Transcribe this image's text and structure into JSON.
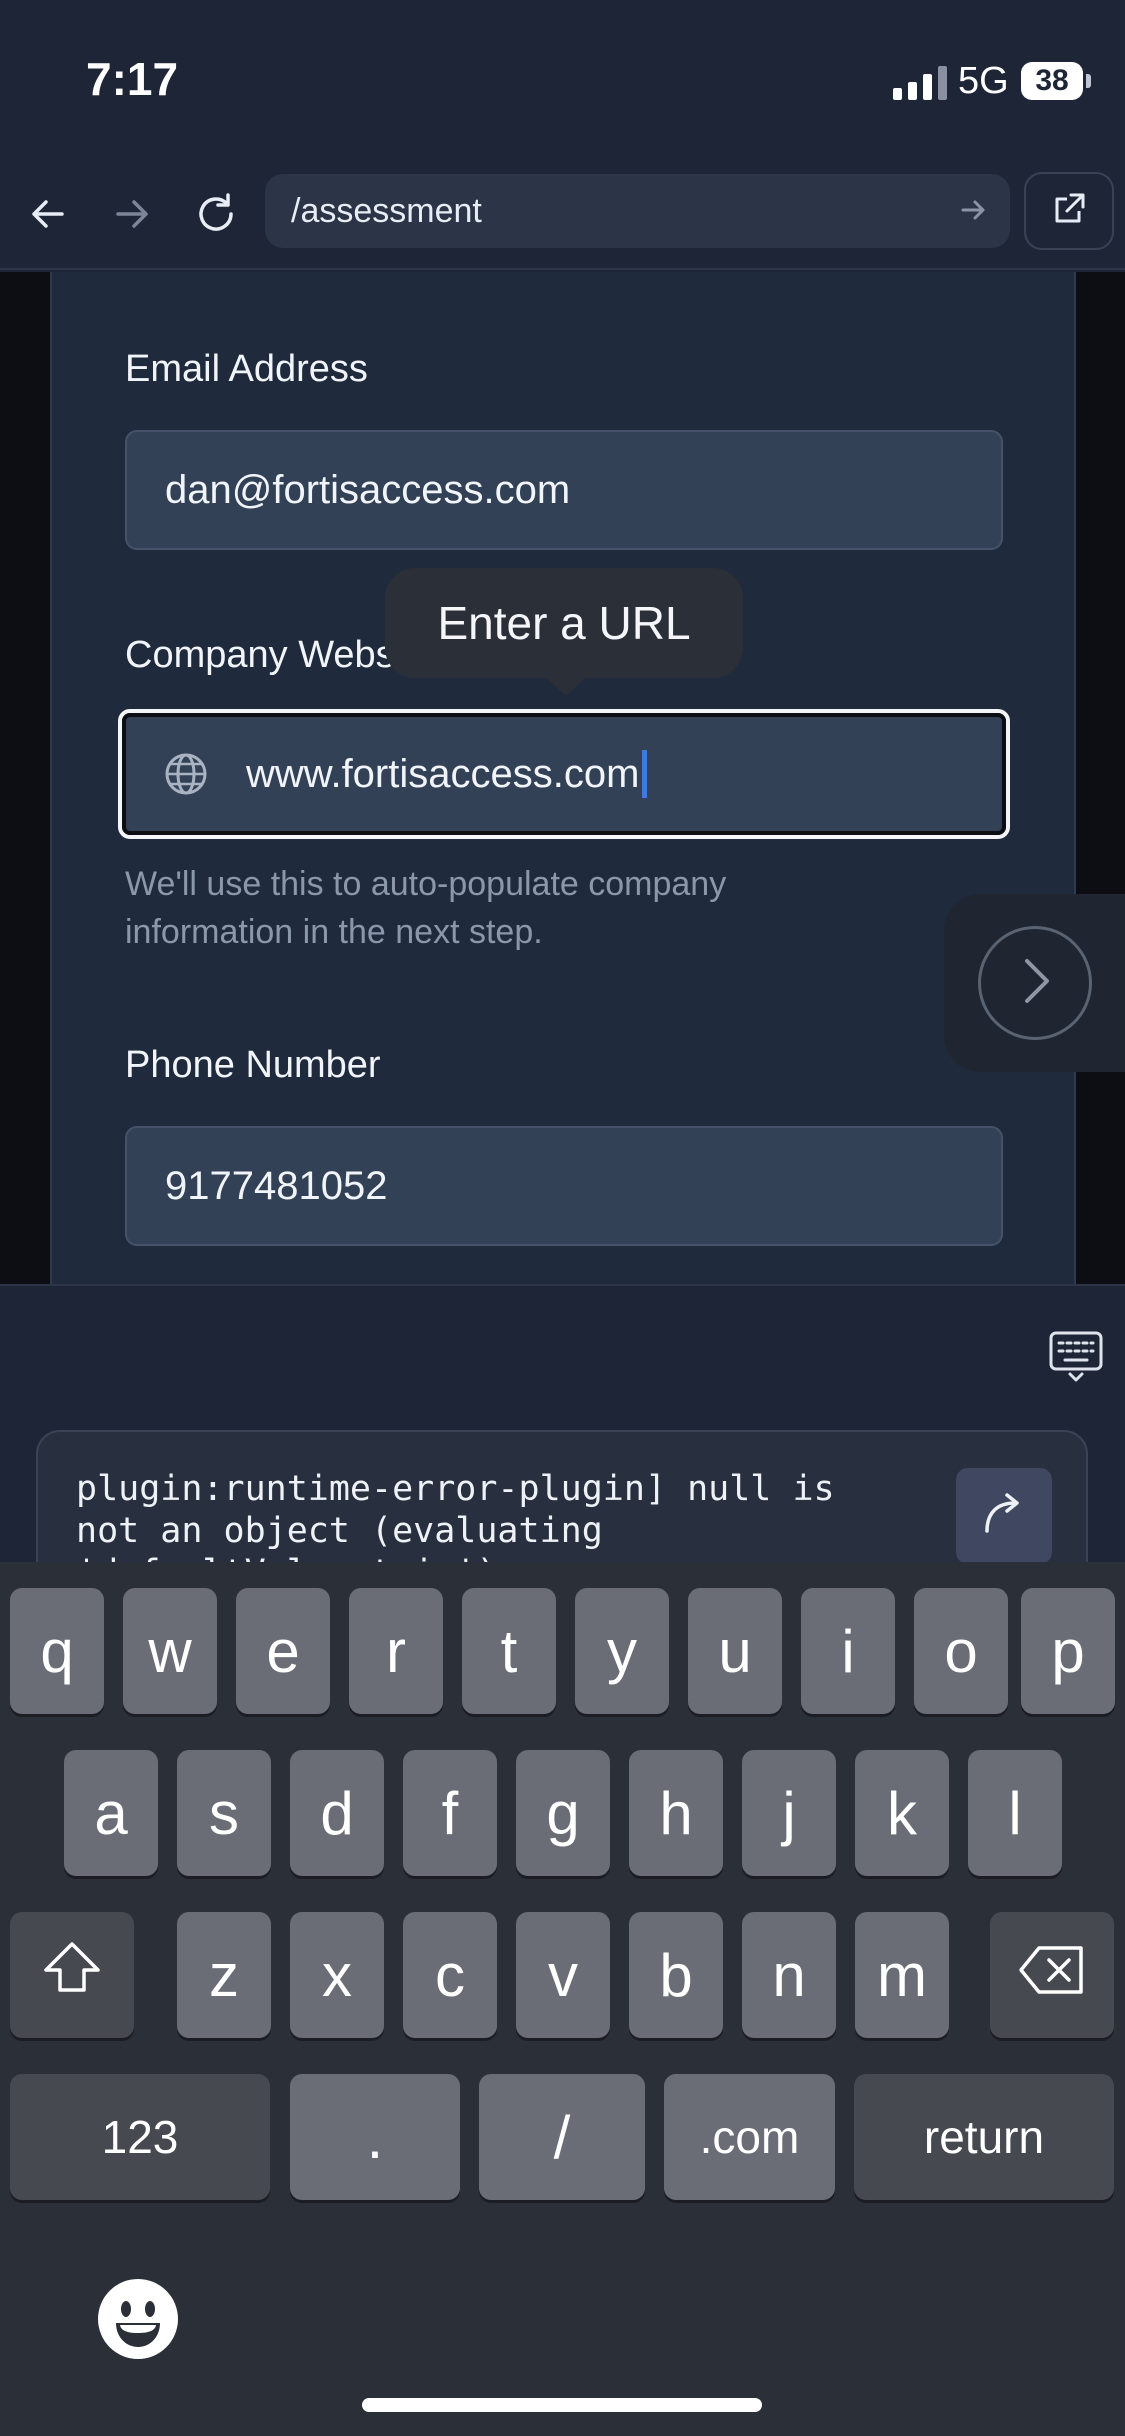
{
  "status": {
    "time": "7:17",
    "network": "5G",
    "battery": "38"
  },
  "browser": {
    "url": "/assessment"
  },
  "form": {
    "email_label": "Email Address",
    "email_value": "dan@fortisaccess.com",
    "website_label": "Company Website",
    "website_value": "www.fortisaccess.com",
    "website_hint": "We'll use this to auto-populate company information in the next step.",
    "tooltip": "Enter a URL",
    "phone_label": "Phone Number",
    "phone_value": "9177481052"
  },
  "console": {
    "text": "plugin:runtime-error-plugin] null is\nnot an object (evaluating\n'defaultValue.trim')"
  },
  "keyboard": {
    "row1": [
      "q",
      "w",
      "e",
      "r",
      "t",
      "y",
      "u",
      "i",
      "o",
      "p"
    ],
    "row2": [
      "a",
      "s",
      "d",
      "f",
      "g",
      "h",
      "j",
      "k",
      "l"
    ],
    "row3": [
      "z",
      "x",
      "c",
      "v",
      "b",
      "n",
      "m"
    ],
    "bottom": {
      "numbers": "123",
      "dot": ".",
      "slash": "/",
      "dotcom": ".com",
      "return": "return"
    }
  }
}
